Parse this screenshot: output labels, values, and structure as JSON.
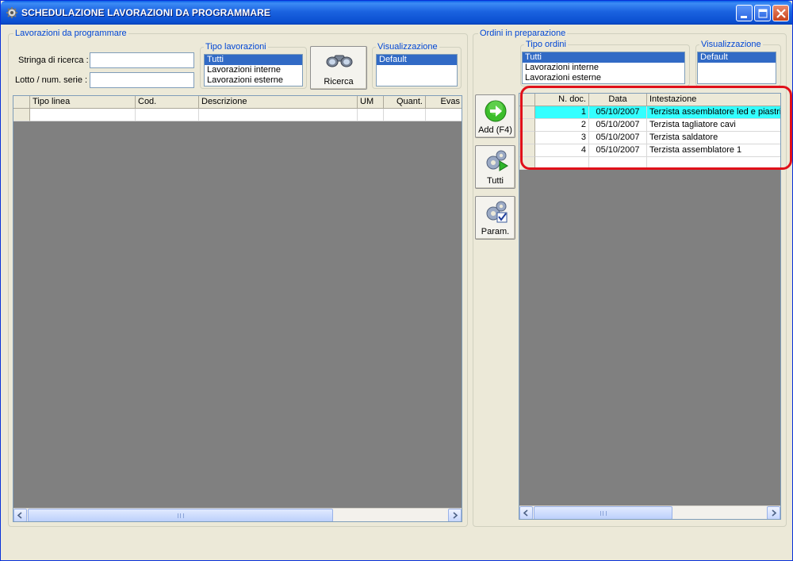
{
  "window": {
    "title": "SCHEDULAZIONE LAVORAZIONI DA PROGRAMMARE",
    "app_icon": "gear-icon"
  },
  "left_panel": {
    "legend": "Lavorazioni da programmare",
    "search_label": "Stringa di ricerca :",
    "search_value": "",
    "lot_label": "Lotto / num. serie :",
    "lot_value": "",
    "tipo_lavorazioni": {
      "legend": "Tipo lavorazioni",
      "items": [
        "Tutti",
        "Lavorazioni interne",
        "Lavorazioni esterne"
      ],
      "selected": "Tutti"
    },
    "search_button_label": "Ricerca",
    "visualizzazione": {
      "legend": "Visualizzazione",
      "items": [
        "Default"
      ]
    },
    "grid": {
      "columns": [
        "Tipo linea",
        "Cod.",
        "Descrizione",
        "UM",
        "Quant.",
        "Evas"
      ]
    }
  },
  "middle_buttons": {
    "add_label": "Add (F4)",
    "all_label": "Tutti",
    "params_label": "Param."
  },
  "right_panel": {
    "legend": "Ordini in preparazione",
    "tipo_ordini": {
      "legend": "Tipo ordini",
      "items": [
        "Tutti",
        "Lavorazioni interne",
        "Lavorazioni esterne"
      ],
      "selected": "Tutti"
    },
    "visualizzazione": {
      "legend": "Visualizzazione",
      "items": [
        "Default"
      ]
    },
    "grid": {
      "columns": [
        "N. doc.",
        "Data",
        "Intestazione"
      ],
      "rows": [
        {
          "n_doc": "1",
          "data": "05/10/2007",
          "intestazione": "Terzista assemblatore led e piastrina",
          "selected": true
        },
        {
          "n_doc": "2",
          "data": "05/10/2007",
          "intestazione": "Terzista tagliatore cavi"
        },
        {
          "n_doc": "3",
          "data": "05/10/2007",
          "intestazione": "Terzista saldatore"
        },
        {
          "n_doc": "4",
          "data": "05/10/2007",
          "intestazione": "Terzista assemblatore 1"
        }
      ]
    }
  },
  "colors": {
    "title_bar": "#0a4fd0",
    "selected_row": "#33ffff",
    "selection": "#316ac5",
    "highlight_ring": "#e0101a",
    "group_legend": "#0046d5"
  }
}
